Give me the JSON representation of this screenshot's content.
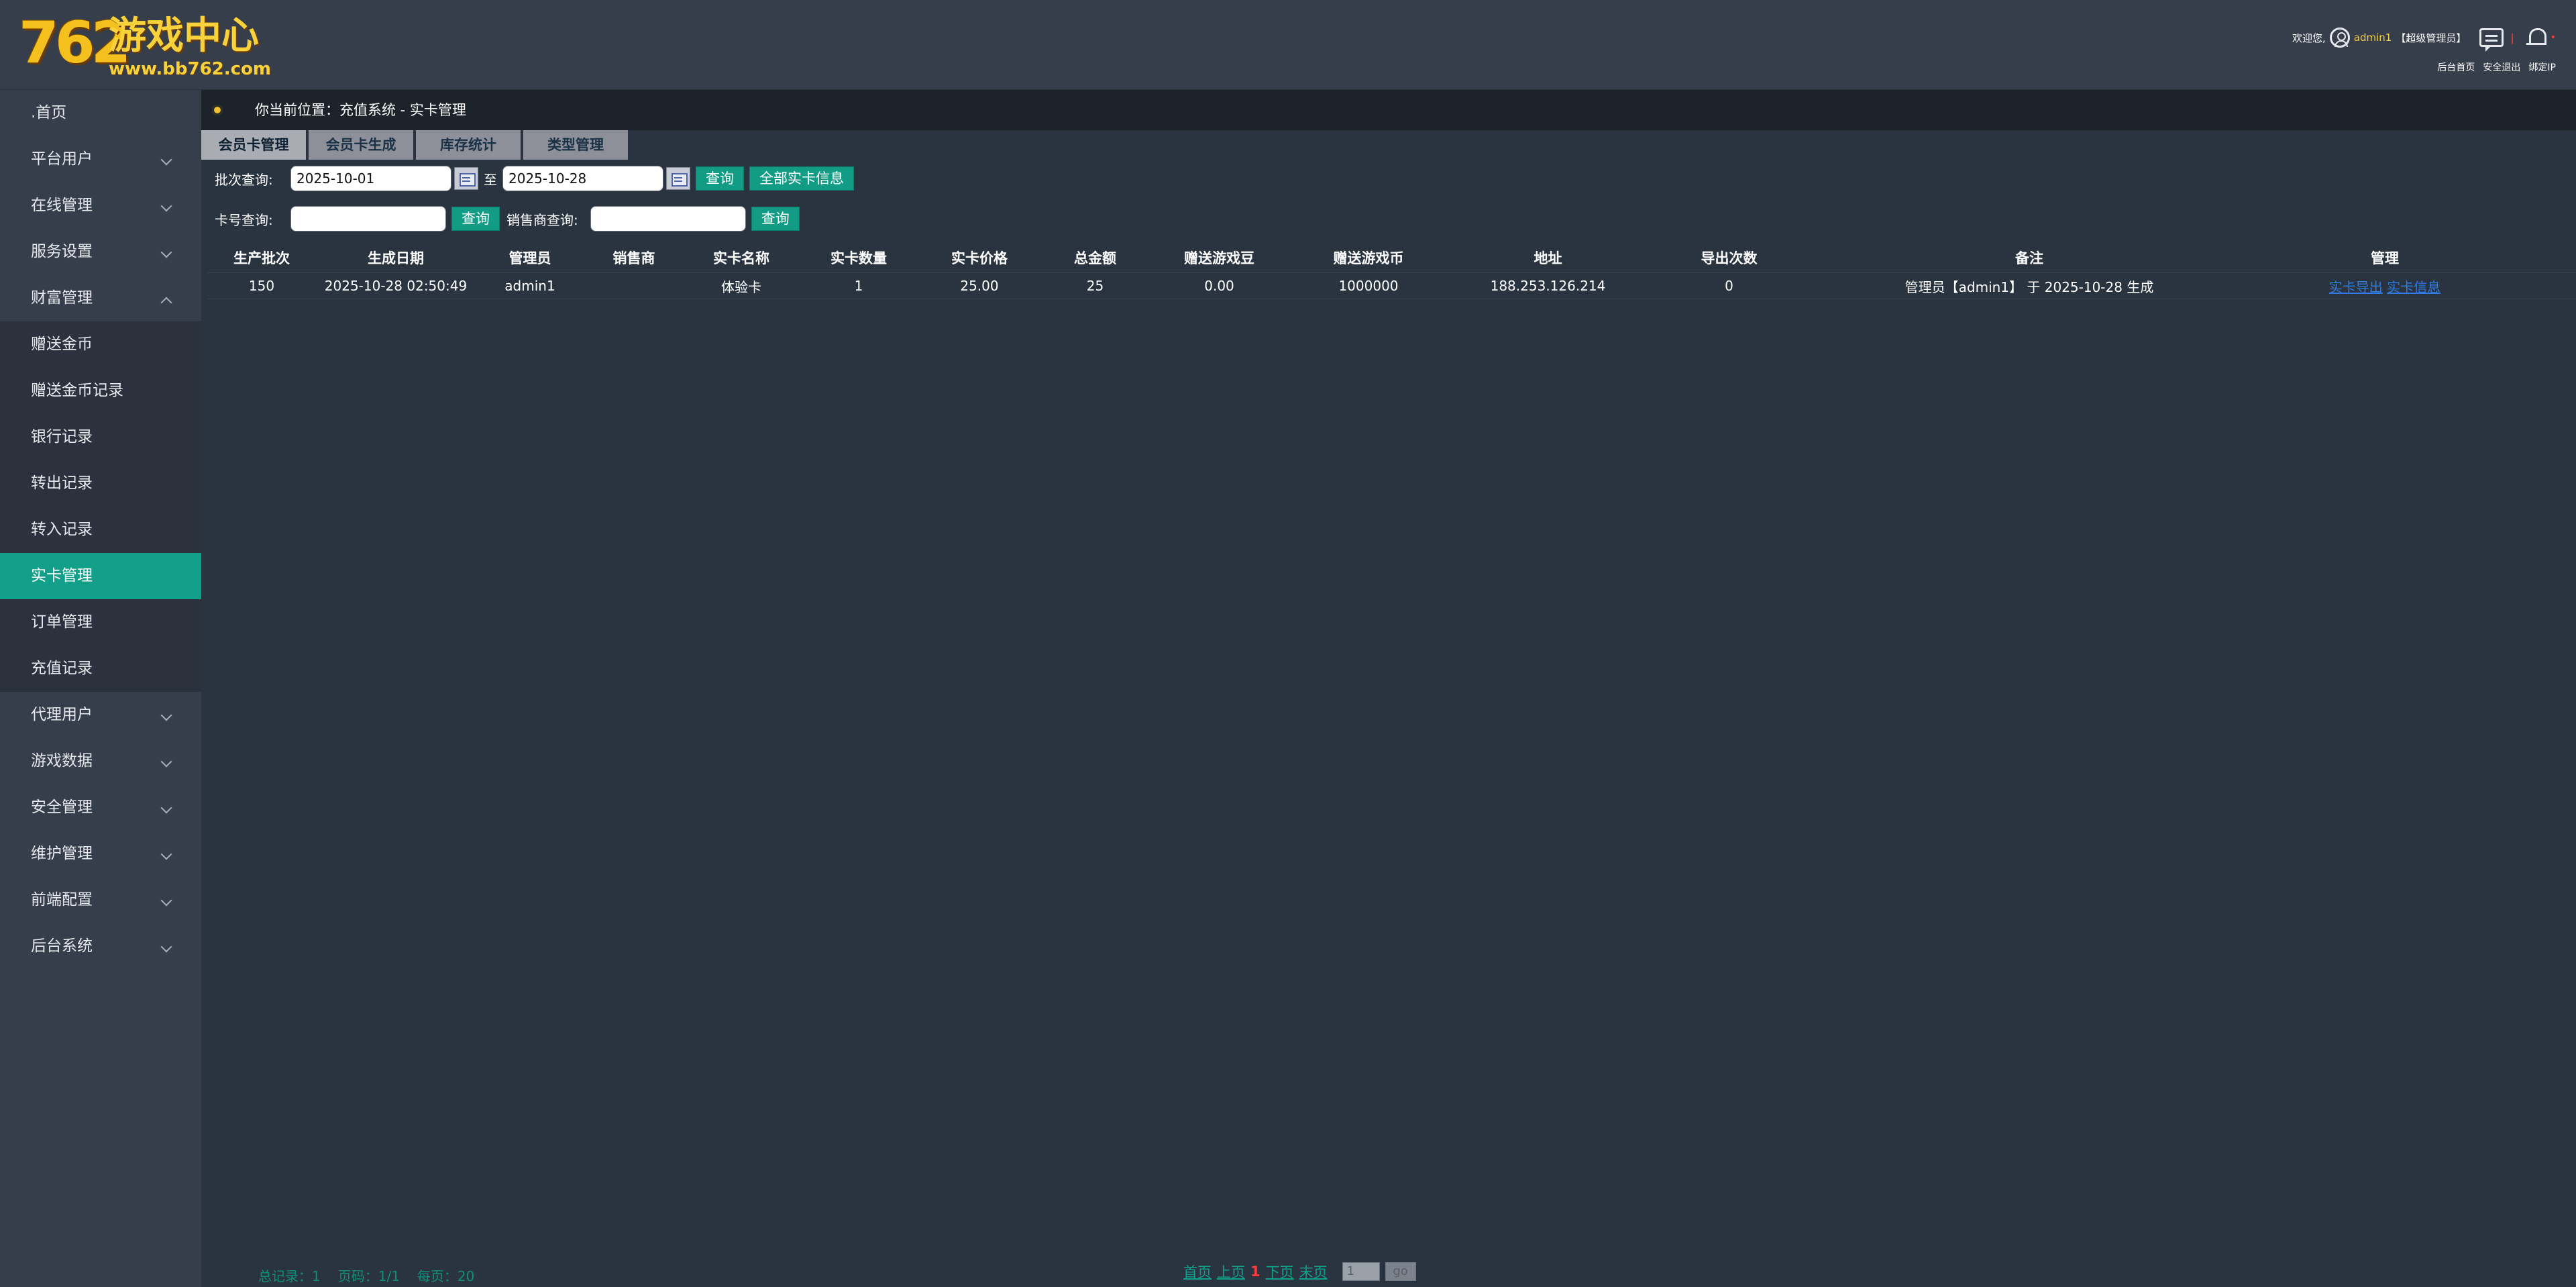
{
  "logo": {
    "number": "762",
    "name": "游戏中心",
    "url": "www.bb762.com"
  },
  "header": {
    "welcome": "欢迎您,",
    "username": "admin1",
    "role": "【超级管理员】",
    "links": [
      "后台首页",
      "安全退出",
      "绑定IP"
    ]
  },
  "sidebar": {
    "items": [
      {
        "label": ".首页"
      },
      {
        "label": "平台用户"
      },
      {
        "label": "在线管理"
      },
      {
        "label": "服务设置"
      },
      {
        "label": "财富管理"
      },
      {
        "label": "代理用户"
      },
      {
        "label": "游戏数据"
      },
      {
        "label": "安全管理"
      },
      {
        "label": "维护管理"
      },
      {
        "label": "前端配置"
      },
      {
        "label": "后台系统"
      }
    ],
    "sub_items": [
      "赠送金币",
      "赠送金币记录",
      "银行记录",
      "转出记录",
      "转入记录",
      "实卡管理",
      "订单管理",
      "充值记录"
    ]
  },
  "breadcrumb": "你当前位置：充值系统 - 实卡管理",
  "tabs": [
    "会员卡管理",
    "会员卡生成",
    "库存统计",
    "类型管理"
  ],
  "query": {
    "batch_label": "批次查询:",
    "start_date": "2025-10-01",
    "to": "至",
    "end_date": "2025-10-28",
    "search_btn": "查询",
    "all_btn": "全部实卡信息",
    "card_label": "卡号查询:",
    "seller_label": "销售商查询:"
  },
  "table": {
    "headers": [
      "生产批次",
      "生成日期",
      "管理员",
      "销售商",
      "实卡名称",
      "实卡数量",
      "实卡价格",
      "总金额",
      "赠送游戏豆",
      "赠送游戏币",
      "地址",
      "导出次数",
      "备注",
      "管理"
    ],
    "rows": [
      {
        "batch": "150",
        "date": "2025-10-28 02:50:49",
        "admin": "admin1",
        "seller": "",
        "card_name": "体验卡",
        "count": "1",
        "price": "25.00",
        "total": "25",
        "bonus_beans": "0.00",
        "bonus_coins": "1000000",
        "address": "188.253.126.214",
        "export_count": "0",
        "note": "管理员【admin1】 于 2025-10-28 生成",
        "action_export": "实卡导出",
        "action_info": "实卡信息"
      }
    ]
  },
  "footer": {
    "total": "总记录：1",
    "page": "页码：1/1",
    "per_page": "每页：20"
  },
  "pager": {
    "first": "首页",
    "prev": "上页",
    "current": "1",
    "next": "下页",
    "last": "末页",
    "page_input": "1",
    "go": "go"
  },
  "colors": {
    "accent": "#12a08b",
    "header_bg": "#363d4b",
    "content_bg": "#2a3440",
    "username": "#f4d03f",
    "link": "#2f7be0"
  }
}
